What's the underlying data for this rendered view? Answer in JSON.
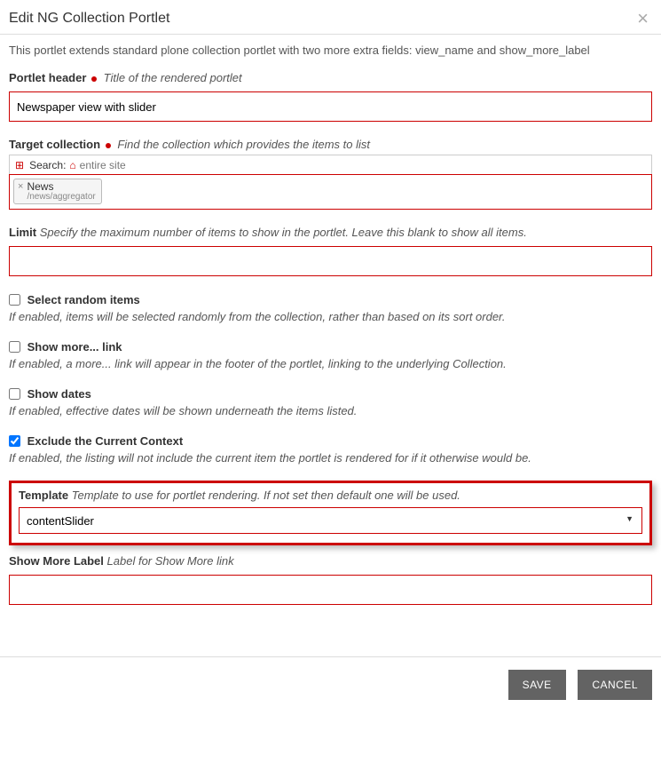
{
  "header": {
    "title": "Edit NG Collection Portlet"
  },
  "description": "This portlet extends standard plone collection portlet with two more extra fields: view_name and show_more_label",
  "fields": {
    "portlet_header": {
      "label": "Portlet header",
      "required": true,
      "help": "Title of the rendered portlet",
      "value": "Newspaper view with slider"
    },
    "target_collection": {
      "label": "Target collection",
      "required": true,
      "help": "Find the collection which provides the items to list",
      "search_label": "Search:",
      "search_scope": "entire site",
      "selected": {
        "name": "News",
        "path": "/news/aggregator"
      }
    },
    "limit": {
      "label": "Limit",
      "help": "Specify the maximum number of items to show in the portlet. Leave this blank to show all items.",
      "value": ""
    },
    "random": {
      "label": "Select random items",
      "checked": false,
      "help": "If enabled, items will be selected randomly from the collection, rather than based on its sort order."
    },
    "show_more": {
      "label": "Show more... link",
      "checked": false,
      "help": "If enabled, a more... link will appear in the footer of the portlet, linking to the underlying Collection."
    },
    "show_dates": {
      "label": "Show dates",
      "checked": false,
      "help": "If enabled, effective dates will be shown underneath the items listed."
    },
    "exclude_current": {
      "label": "Exclude the Current Context",
      "checked": true,
      "help": "If enabled, the listing will not include the current item the portlet is rendered for if it otherwise would be."
    },
    "template": {
      "label": "Template",
      "help": "Template to use for portlet rendering. If not set then default one will be used.",
      "value": "contentSlider"
    },
    "show_more_label": {
      "label": "Show More Label",
      "help": "Label for Show More link",
      "value": ""
    }
  },
  "buttons": {
    "save": "SAVE",
    "cancel": "CANCEL"
  }
}
